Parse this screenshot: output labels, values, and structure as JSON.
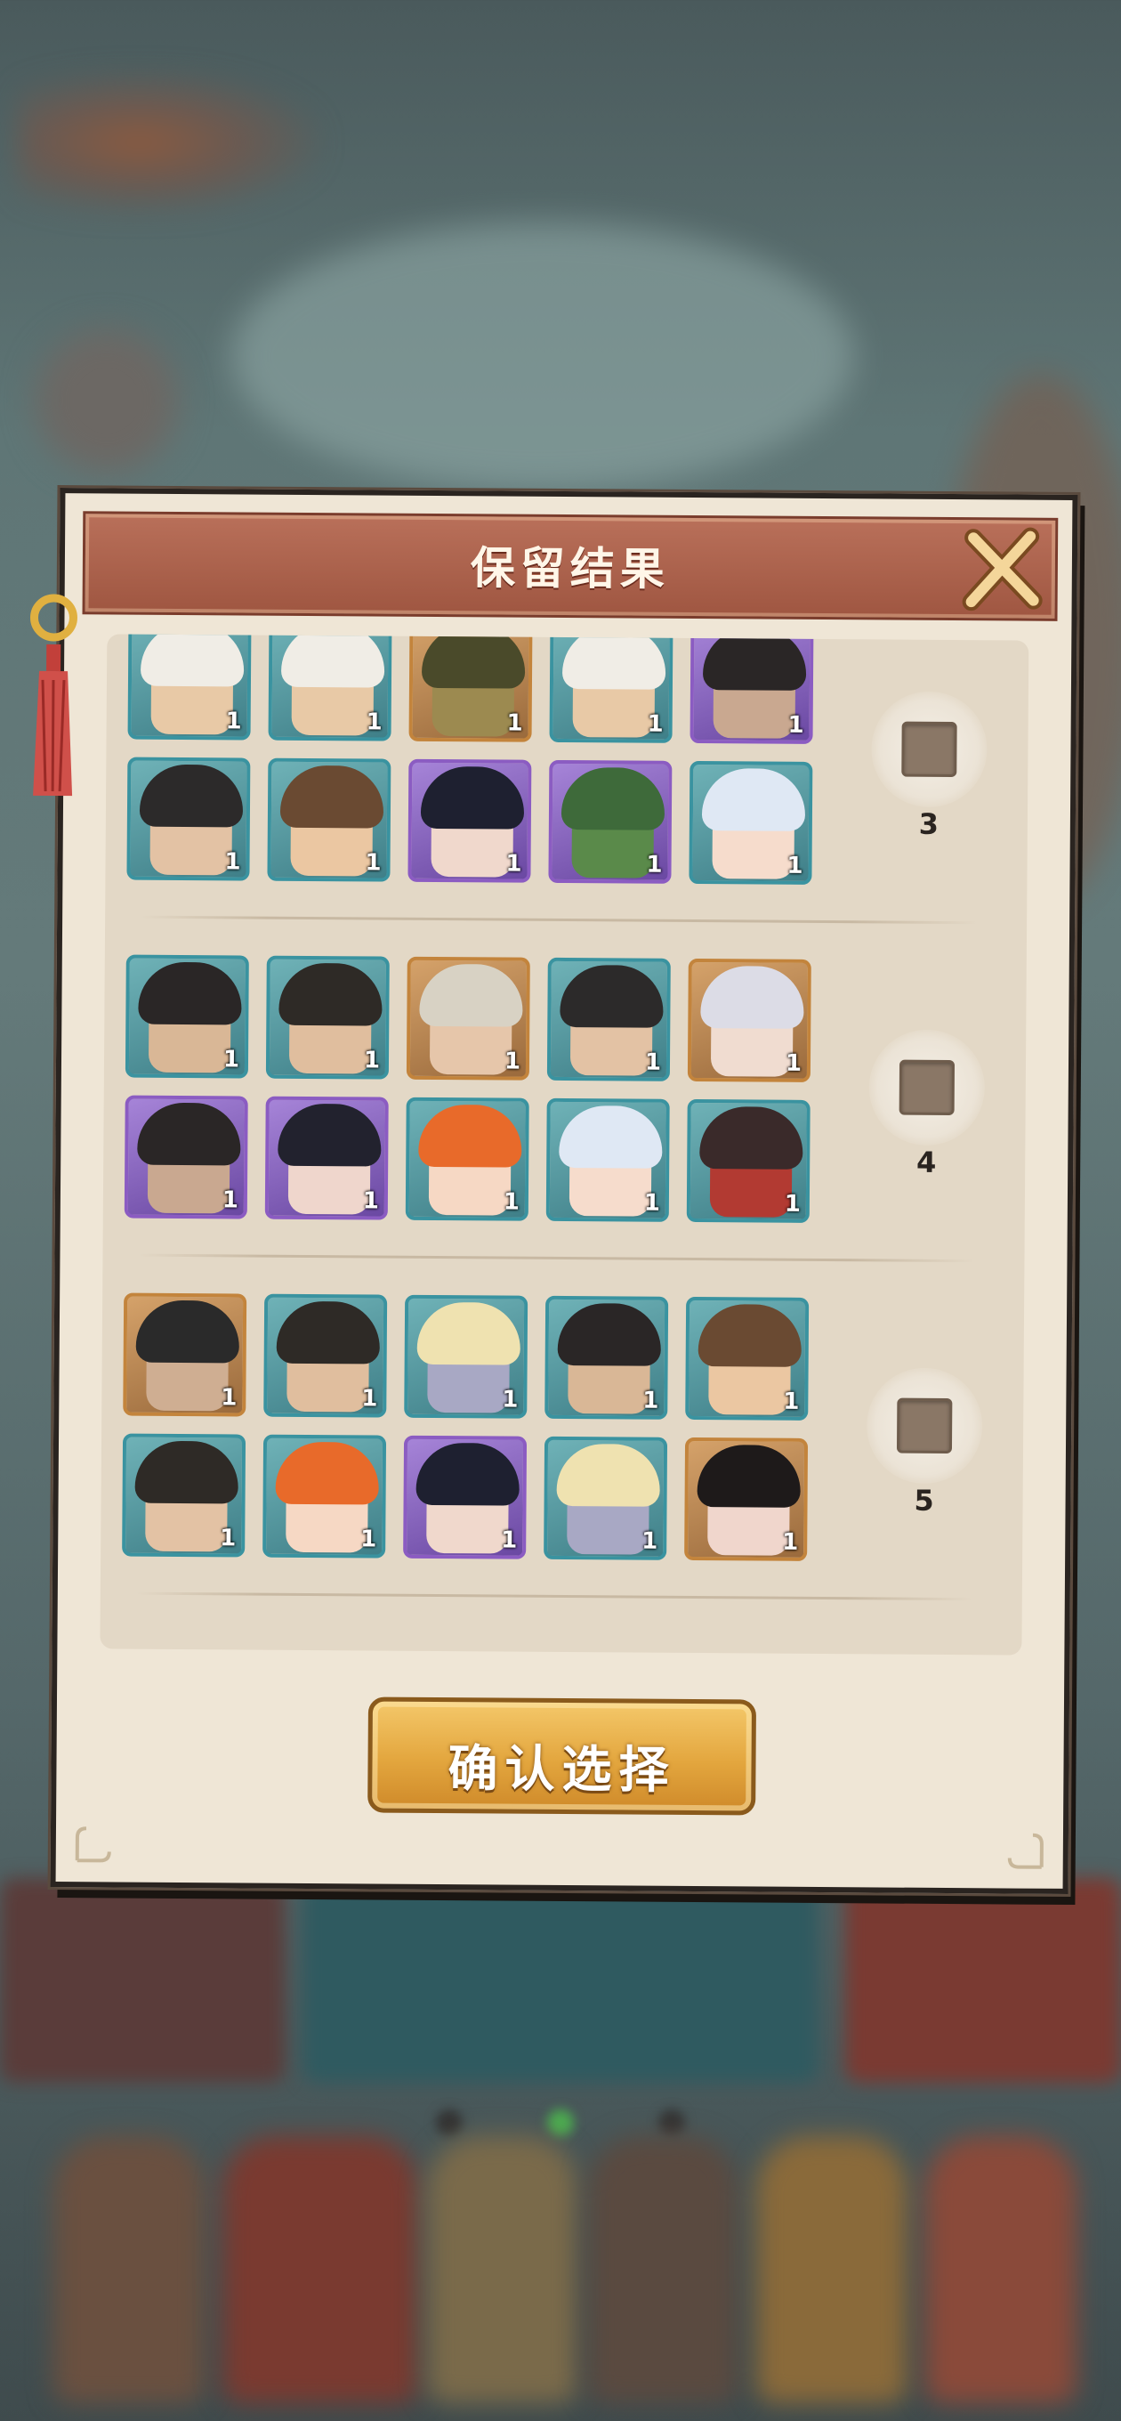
{
  "dialog": {
    "title": "保留结果",
    "confirm_label": "确认选择"
  },
  "groups": [
    {
      "number": "3",
      "checked": false,
      "rows": [
        [
          {
            "rarity": "teal",
            "count": "1",
            "hair": "#f0ede6",
            "skin": "#e8c9a6"
          },
          {
            "rarity": "teal",
            "count": "1",
            "hair": "#f0ede6",
            "skin": "#e8c9a6"
          },
          {
            "rarity": "gold",
            "count": "1",
            "hair": "#4a4a2a",
            "skin": "#9c8a50"
          },
          {
            "rarity": "teal",
            "count": "1",
            "hair": "#f0ede6",
            "skin": "#e8c9a6"
          },
          {
            "rarity": "purple",
            "count": "1",
            "hair": "#2a2626",
            "skin": "#c9a890"
          }
        ],
        [
          {
            "rarity": "teal",
            "count": "1",
            "hair": "#2c2a2a",
            "skin": "#e3c2a4"
          },
          {
            "rarity": "teal",
            "count": "1",
            "hair": "#6a4a32",
            "skin": "#ebc7a2"
          },
          {
            "rarity": "purple",
            "count": "1",
            "hair": "#1e2030",
            "skin": "#f0d8cc"
          },
          {
            "rarity": "purple",
            "count": "1",
            "hair": "#3e6a3a",
            "skin": "#5a8a4a"
          },
          {
            "rarity": "teal",
            "count": "1",
            "hair": "#dfe8f4",
            "skin": "#f6dccc"
          }
        ]
      ]
    },
    {
      "number": "4",
      "checked": false,
      "rows": [
        [
          {
            "rarity": "teal",
            "count": "1",
            "hair": "#2a2626",
            "skin": "#d9b796"
          },
          {
            "rarity": "teal",
            "count": "1",
            "hair": "#2e2a26",
            "skin": "#e0be9e"
          },
          {
            "rarity": "gold",
            "count": "1",
            "hair": "#d8d2c4",
            "skin": "#e6c6aa"
          },
          {
            "rarity": "teal",
            "count": "1",
            "hair": "#2c2a2a",
            "skin": "#e3c2a4"
          },
          {
            "rarity": "gold",
            "count": "1",
            "hair": "#dcdce6",
            "skin": "#f0dcd0"
          }
        ],
        [
          {
            "rarity": "purple",
            "count": "1",
            "hair": "#2a2626",
            "skin": "#c9a890"
          },
          {
            "rarity": "purple",
            "count": "1",
            "hair": "#22222e",
            "skin": "#efd6cc"
          },
          {
            "rarity": "teal",
            "count": "1",
            "hair": "#e86a2a",
            "skin": "#f6d8c4"
          },
          {
            "rarity": "teal",
            "count": "1",
            "hair": "#dfe8f4",
            "skin": "#f6dccc"
          },
          {
            "rarity": "teal",
            "count": "1",
            "hair": "#3a2a2a",
            "skin": "#b23a32"
          }
        ]
      ]
    },
    {
      "number": "5",
      "checked": false,
      "rows": [
        [
          {
            "rarity": "gold",
            "count": "1",
            "hair": "#2a2a2a",
            "skin": "#cfae92"
          },
          {
            "rarity": "teal",
            "count": "1",
            "hair": "#2e2a26",
            "skin": "#e0be9e"
          },
          {
            "rarity": "teal",
            "count": "1",
            "hair": "#efe2b0",
            "skin": "#a8a8c4"
          },
          {
            "rarity": "teal",
            "count": "1",
            "hair": "#2a2626",
            "skin": "#d9b796"
          },
          {
            "rarity": "teal",
            "count": "1",
            "hair": "#6a4a32",
            "skin": "#ebc7a2"
          }
        ],
        [
          {
            "rarity": "teal",
            "count": "1",
            "hair": "#2e2a26",
            "skin": "#e3c2a4"
          },
          {
            "rarity": "teal",
            "count": "1",
            "hair": "#e86a2a",
            "skin": "#f6d8c4"
          },
          {
            "rarity": "purple",
            "count": "1",
            "hair": "#1e2030",
            "skin": "#f0d8cc"
          },
          {
            "rarity": "teal",
            "count": "1",
            "hair": "#efe2b0",
            "skin": "#a8a8c4"
          },
          {
            "rarity": "gold",
            "count": "1",
            "hair": "#1e1a1a",
            "skin": "#f0d6cc"
          }
        ]
      ]
    }
  ]
}
